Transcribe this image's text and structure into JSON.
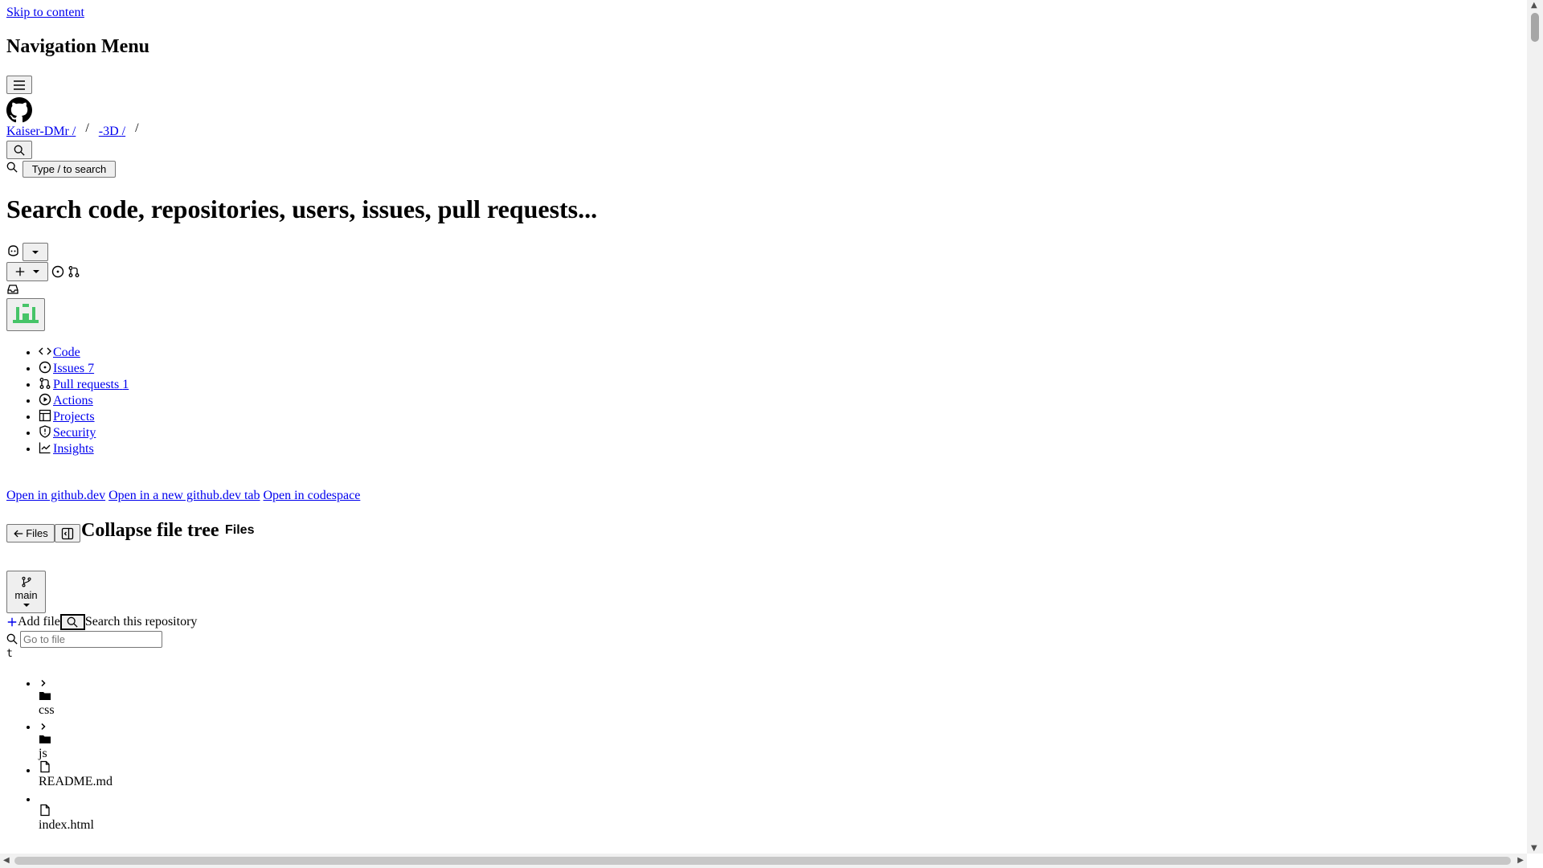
{
  "skip_link": "Skip to content",
  "nav_menu_heading": "Navigation Menu",
  "breadcrumb": {
    "owner": "Kaiser-DMr",
    "repo": "-3D",
    "separator": "/"
  },
  "search": {
    "button_label": "Type / to search",
    "heading": "Search code, repositories, users, issues, pull requests..."
  },
  "repo_tabs": [
    {
      "label": "Code",
      "icon": "code-icon"
    },
    {
      "label": "Issues",
      "count": "7",
      "icon": "issue-opened-icon"
    },
    {
      "label": "Pull requests",
      "count": "1",
      "icon": "git-pull-request-icon"
    },
    {
      "label": "Actions",
      "icon": "play-icon"
    },
    {
      "label": "Projects",
      "icon": "table-icon"
    },
    {
      "label": "Security",
      "icon": "shield-icon"
    },
    {
      "label": "Insights",
      "icon": "graph-icon"
    }
  ],
  "open_links": {
    "github_dev": "Open in github.dev",
    "github_dev_tab": "Open in a new github.dev tab",
    "codespace": "Open in codespace"
  },
  "file_tree_header": {
    "back_button": "Files",
    "collapse_label": "Collapse file tree",
    "files_heading": "Files"
  },
  "branch": {
    "name": "main"
  },
  "add_file": "Add file",
  "search_repo": "Search this repository",
  "go_to_file": {
    "placeholder": "Go to file",
    "shortcut": "t"
  },
  "tree_items": [
    {
      "name": "css",
      "type": "folder",
      "icon": "folder-icon"
    },
    {
      "name": "js",
      "type": "folder",
      "icon": "folder-icon"
    },
    {
      "name": "README.md",
      "type": "file",
      "icon": "file-icon"
    },
    {
      "name": "index.html",
      "type": "file",
      "icon": "file-icon"
    }
  ],
  "colors": {
    "link": "#0000ee",
    "avatar": "#46c468"
  }
}
